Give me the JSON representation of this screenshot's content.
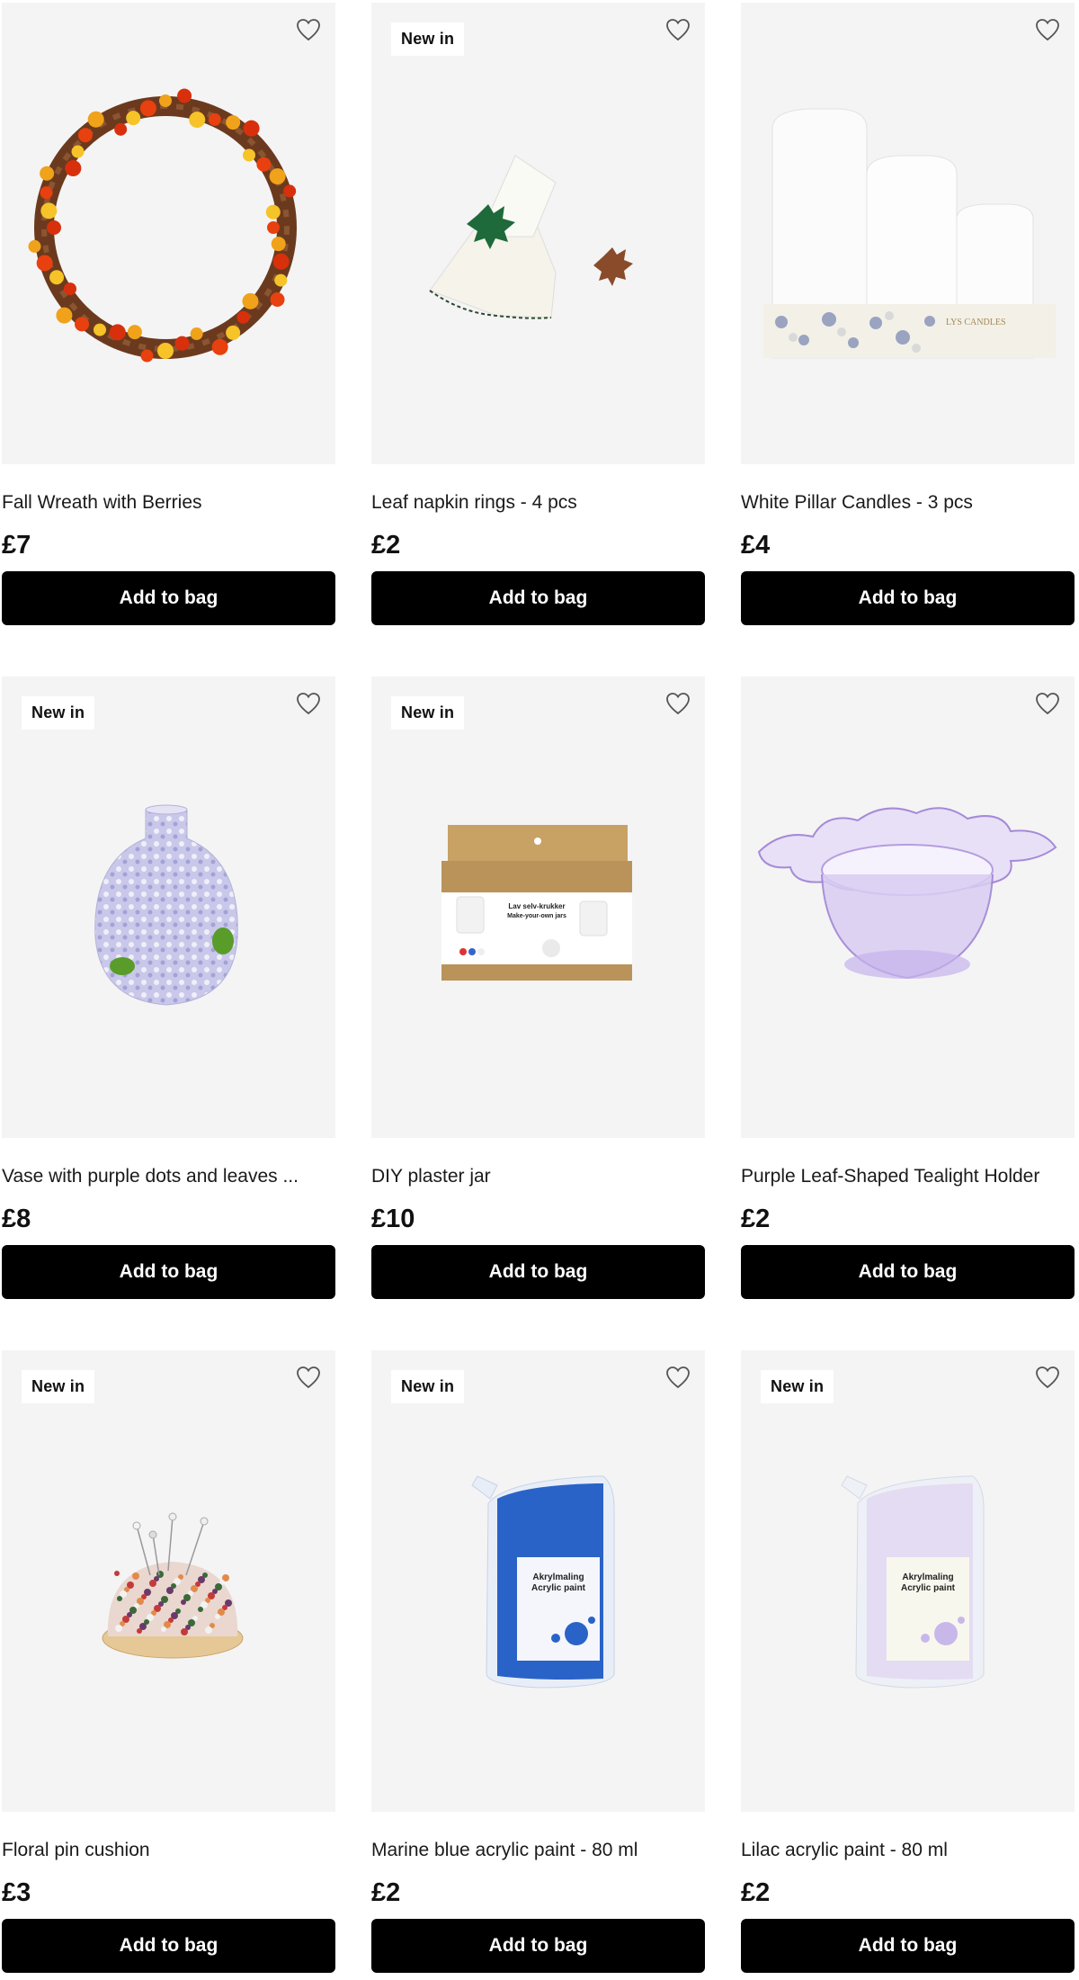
{
  "colors": {
    "button_bg": "#000000",
    "button_text": "#ffffff",
    "card_bg": "#f4f4f4",
    "badge_bg": "#ffffff"
  },
  "products": [
    {
      "name": "Fall Wreath with Berries",
      "price": "£7",
      "badge": "",
      "button": "Add to bag",
      "icon": "heart-outline-icon"
    },
    {
      "name": "Leaf napkin rings - 4 pcs",
      "price": "£2",
      "badge": "New in",
      "button": "Add to bag",
      "icon": "heart-outline-icon"
    },
    {
      "name": "White Pillar Candles - 3 pcs",
      "price": "£4",
      "badge": "",
      "button": "Add to bag",
      "icon": "heart-outline-icon"
    },
    {
      "name": "Vase with purple dots and leaves ...",
      "price": "£8",
      "badge": "New in",
      "button": "Add to bag",
      "icon": "heart-outline-icon"
    },
    {
      "name": "DIY plaster jar",
      "price": "£10",
      "badge": "New in",
      "button": "Add to bag",
      "icon": "heart-outline-icon"
    },
    {
      "name": "Purple Leaf-Shaped Tealight Holder",
      "price": "£2",
      "badge": "",
      "button": "Add to bag",
      "icon": "heart-outline-icon"
    },
    {
      "name": "Floral pin cushion",
      "price": "£3",
      "badge": "New in",
      "button": "Add to bag",
      "icon": "heart-outline-icon"
    },
    {
      "name": "Marine blue acrylic paint - 80 ml",
      "price": "£2",
      "badge": "New in",
      "button": "Add to bag",
      "icon": "heart-outline-icon"
    },
    {
      "name": "Lilac acrylic paint - 80 ml",
      "price": "£2",
      "badge": "New in",
      "button": "Add to bag",
      "icon": "heart-outline-icon"
    }
  ],
  "art_text": {
    "candles_label": "LYS CANDLES",
    "plaster_label": "Lav selv-krukker",
    "plaster_sub": "Make-your-own jars",
    "paint_label_1": "Akrylmaling",
    "paint_label_2": "Acrylic paint"
  }
}
